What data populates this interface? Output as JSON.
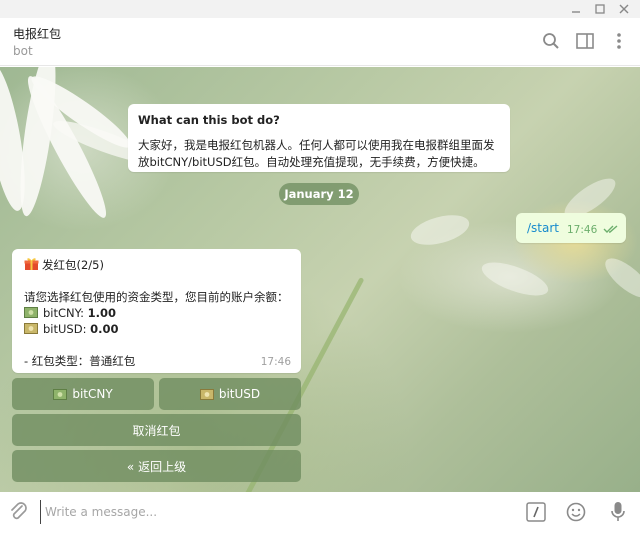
{
  "window": {
    "controls": [
      "minimize",
      "maximize",
      "close"
    ]
  },
  "header": {
    "title": "电报红包",
    "subtitle": "bot",
    "icons": [
      "search-icon",
      "sidebar-toggle-icon",
      "more-vertical-icon"
    ]
  },
  "intro": {
    "title": "What can this bot do?",
    "text_line1": "大家好，我是电报红包机器人。任何人都可以使用我在电报群组里面发",
    "text_line2": "放bitCNY/bitUSD红包。自动处理充值提现，无手续费，方便快捷。"
  },
  "date_divider": "January 12",
  "outgoing": {
    "text": "/start",
    "time": "17:46",
    "status": "read"
  },
  "bot_message": {
    "heading": "发红包(2/5)",
    "prompt": "请您选择红包使用的资金类型，您目前的账户余额：",
    "balances": [
      {
        "label": "bitCNY: ",
        "value": "1.00"
      },
      {
        "label": "bitUSD: ",
        "value": "0.00"
      }
    ],
    "type_line": "- 红包类型：普通红包",
    "time": "17:46"
  },
  "keyboard": {
    "bitcny": "bitCNY",
    "bitusd": "bitUSD",
    "cancel": "取消红包",
    "back": "« 返回上级"
  },
  "composer": {
    "placeholder": "Write a message...",
    "value": ""
  },
  "colors": {
    "accent_link": "#168acd",
    "bubble_out": "#effdde",
    "keyboard_button": "#6e8c5f",
    "read_check": "#6cae6c"
  }
}
